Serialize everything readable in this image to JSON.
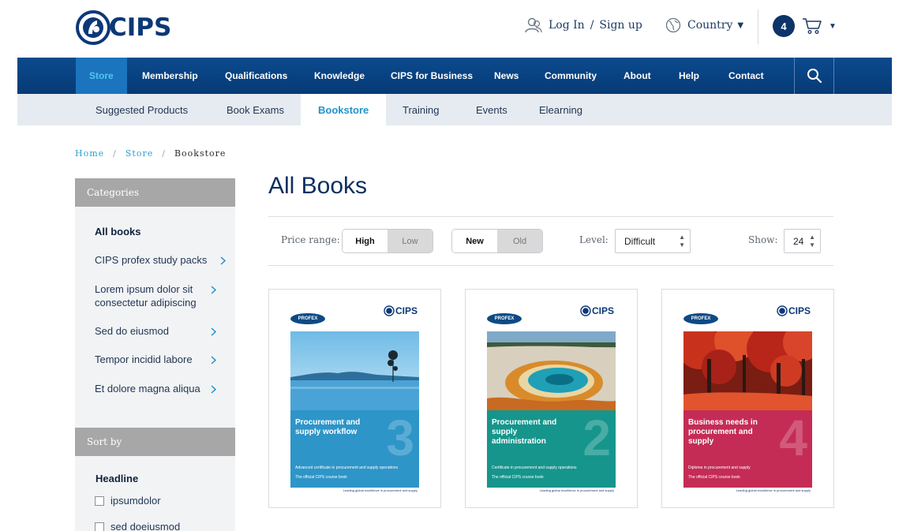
{
  "brand": {
    "name": "CIPS",
    "color": "#0c3877"
  },
  "header": {
    "login_label": "Log In",
    "separator": "/",
    "signup_label": "Sign up",
    "country_label": "Country",
    "cart_count": "4",
    "icons": {
      "user": "user-icon",
      "globe": "globe-icon",
      "cart": "cart-icon",
      "caret": "caret-down-icon"
    }
  },
  "main_nav": {
    "items": [
      {
        "label": "Store",
        "active": true
      },
      {
        "label": "Membership"
      },
      {
        "label": "Qualifications"
      },
      {
        "label": "Knowledge"
      },
      {
        "label": "CIPS for Business"
      },
      {
        "label": "News"
      },
      {
        "label": "Community"
      },
      {
        "label": "About"
      },
      {
        "label": "Help"
      },
      {
        "label": "Contact"
      }
    ],
    "search_icon": "search-icon"
  },
  "sub_nav": {
    "items": [
      {
        "label": "Suggested Products"
      },
      {
        "label": "Book Exams"
      },
      {
        "label": "Bookstore",
        "active": true
      },
      {
        "label": "Training"
      },
      {
        "label": "Events"
      },
      {
        "label": "Elearning"
      }
    ]
  },
  "breadcrumb": {
    "items": [
      "Home",
      "Store",
      "Bookstore"
    ],
    "separator": "/"
  },
  "sidebar": {
    "categories_heading": "Categories",
    "categories": [
      {
        "label": "All books"
      },
      {
        "label": "CIPS profex study packs"
      },
      {
        "label": "Lorem ipsum dolor sit consectetur adipiscing"
      },
      {
        "label": "Sed do eiusmod"
      },
      {
        "label": "Tempor incidid labore"
      },
      {
        "label": "Et dolore magna aliqua"
      }
    ],
    "sort_heading": "Sort by",
    "sort_group_title": "Headline",
    "sort_options": [
      {
        "label": "ipsumdolor",
        "checked": false
      },
      {
        "label": "sed doeiusmod",
        "checked": false
      }
    ]
  },
  "content": {
    "title": "All Books",
    "filters": {
      "price_label": "Price range:",
      "price_options": [
        "High",
        "Low"
      ],
      "price_selected": "High",
      "age_options": [
        "New",
        "Old"
      ],
      "age_selected": "New",
      "level_label": "Level:",
      "level_value": "Difficult",
      "show_label": "Show:",
      "show_value": "24"
    },
    "products": [
      {
        "publisher": "PROFEX",
        "brand": "CIPS",
        "title": "Procurement and supply workflow",
        "number": "3",
        "subtitle": "Advanced certificate in procurement and supply operations",
        "course_line": "The official CIPS course book",
        "tagline": "Leading global excellence in procurement and supply",
        "band_color": "#2e95c8"
      },
      {
        "publisher": "PROFEX",
        "brand": "CIPS",
        "title": "Procurement and supply administration",
        "number": "2",
        "subtitle": "Certificate in procurement and supply operations",
        "course_line": "The official CIPS course book",
        "tagline": "Leading global excellence in procurement and supply",
        "band_color": "#16958c"
      },
      {
        "publisher": "PROFEX",
        "brand": "CIPS",
        "title": "Business needs in procurement and supply",
        "number": "4",
        "subtitle": "Diploma in procurement and supply",
        "course_line": "The official CIPS course book",
        "tagline": "Leading global excellence in procurement and supply",
        "band_color": "#c42c55"
      }
    ]
  },
  "colors": {
    "nav_bg": "#063a75",
    "nav_active_bg": "#1b74bd",
    "nav_active_text": "#51c6f0",
    "subnav_bg": "#e6ebf1",
    "subnav_active_text": "#2193c8",
    "link": "#2aa2d4",
    "sidebar_head": "#a7a7a7"
  }
}
